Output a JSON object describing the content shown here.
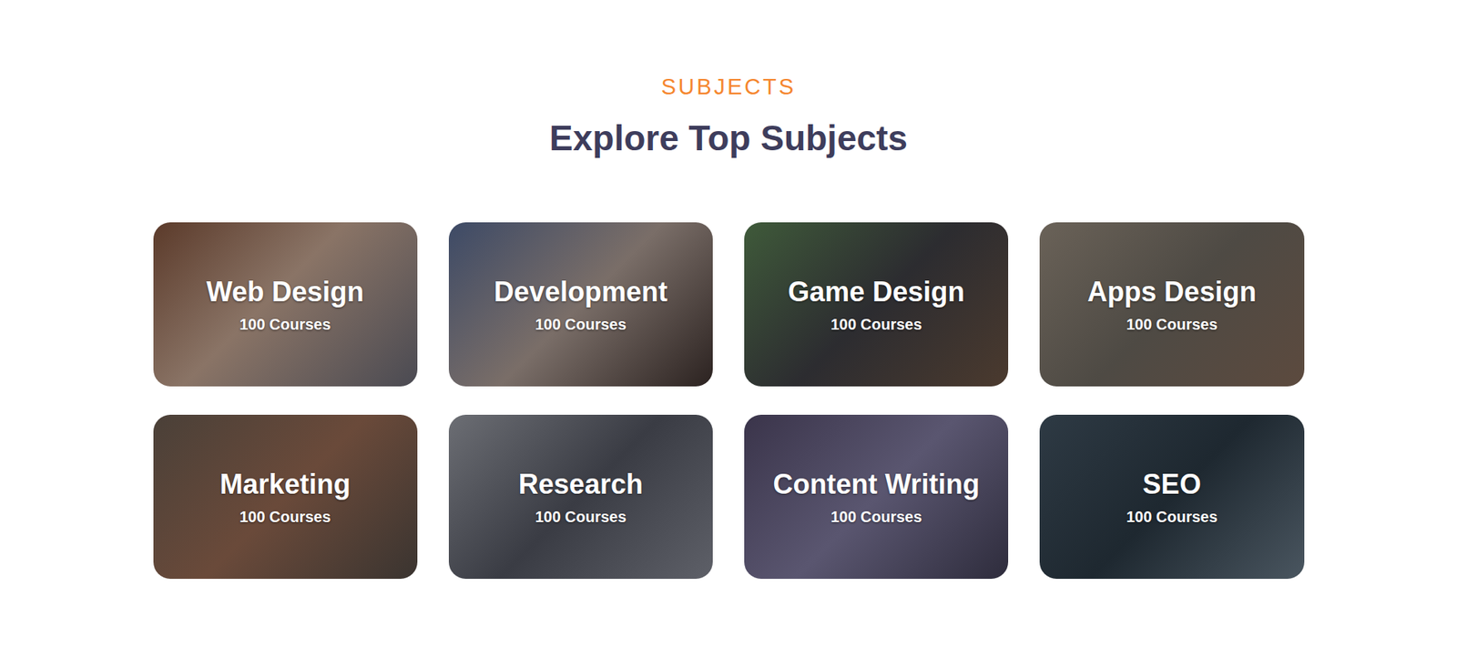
{
  "section": {
    "label": "SUBJECTS",
    "title": "Explore Top Subjects"
  },
  "subjects": [
    {
      "title": "Web Design",
      "count": "100 Courses"
    },
    {
      "title": "Development",
      "count": "100 Courses"
    },
    {
      "title": "Game Design",
      "count": "100 Courses"
    },
    {
      "title": "Apps Design",
      "count": "100 Courses"
    },
    {
      "title": "Marketing",
      "count": "100 Courses"
    },
    {
      "title": "Research",
      "count": "100 Courses"
    },
    {
      "title": "Content Writing",
      "count": "100 Courses"
    },
    {
      "title": "SEO",
      "count": "100 Courses"
    }
  ]
}
